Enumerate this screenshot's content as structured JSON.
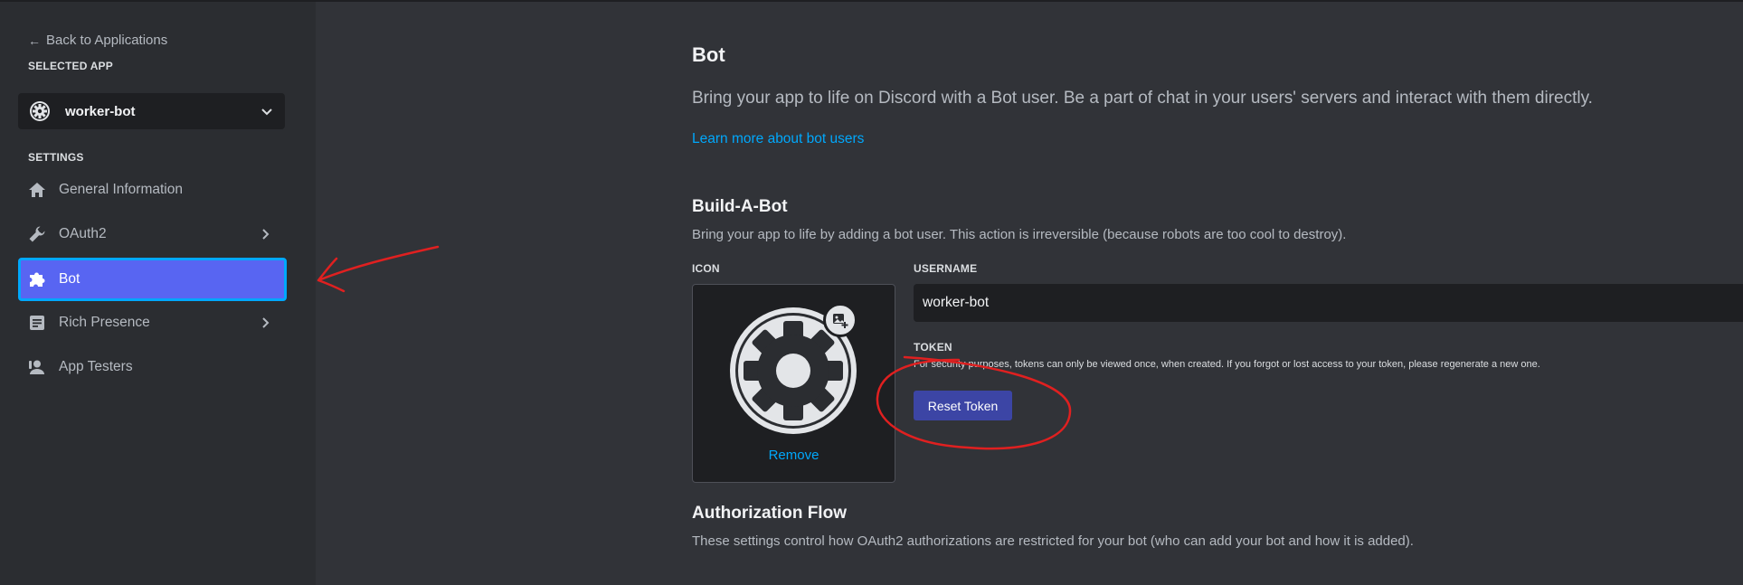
{
  "sidebar": {
    "back_label": "Back to Applications",
    "selected_app_label": "SELECTED APP",
    "selected_app_name": "worker-bot",
    "settings_label": "SETTINGS",
    "items": [
      {
        "label": "General Information",
        "icon": "home-icon"
      },
      {
        "label": "OAuth2",
        "icon": "wrench-icon"
      },
      {
        "label": "Bot",
        "icon": "puzzle-icon",
        "active": true
      },
      {
        "label": "Rich Presence",
        "icon": "document-icon"
      },
      {
        "label": "App Testers",
        "icon": "user-icon"
      }
    ]
  },
  "main": {
    "title": "Bot",
    "lead": "Bring your app to life on Discord with a Bot user. Be a part of chat in your users' servers and interact with them directly.",
    "learn_more": "Learn more about bot users",
    "build": {
      "title": "Build-A-Bot",
      "description": "Bring your app to life by adding a bot user. This action is irreversible (because robots are too cool to destroy).",
      "icon_label": "ICON",
      "remove_label": "Remove",
      "username_label": "USERNAME",
      "username_value": "worker-bot",
      "token_label": "TOKEN",
      "token_note": "For security purposes, tokens can only be viewed once, when created. If you forgot or lost access to your token, please regenerate a new one.",
      "reset_label": "Reset Token"
    },
    "auth": {
      "title": "Authorization Flow",
      "description": "These settings control how OAuth2 authorizations are restricted for your bot (who can add your bot and how it is added)."
    }
  },
  "colors": {
    "accent": "#5865f2",
    "link": "#00a8fc",
    "button": "#3c45a5",
    "annotation": "#e02020"
  }
}
